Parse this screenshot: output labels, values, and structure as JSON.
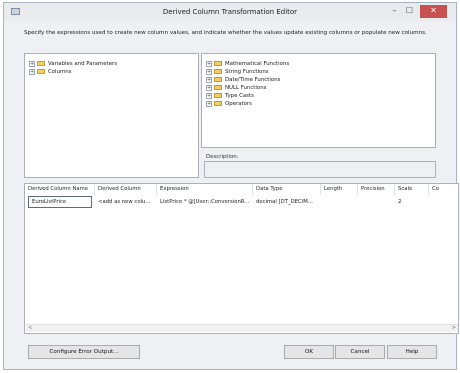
{
  "window": {
    "title": "Derived Column Transformation Editor",
    "controls": {
      "minimize": "–",
      "maximize": "☐",
      "close": "✕"
    }
  },
  "description": "Specify the expressions used to create new column values, and indicate whether the values update existing columns or populate new columns.",
  "left_tree": {
    "items": [
      {
        "expander": "+",
        "label": "Variables and Parameters"
      },
      {
        "expander": "+",
        "label": "Columns"
      }
    ]
  },
  "right_tree": {
    "items": [
      {
        "expander": "+",
        "label": "Mathematical Functions"
      },
      {
        "expander": "+",
        "label": "String Functions"
      },
      {
        "expander": "+",
        "label": "Date/Time Functions"
      },
      {
        "expander": "+",
        "label": "NULL Functions"
      },
      {
        "expander": "+",
        "label": "Type Casts"
      },
      {
        "expander": "+",
        "label": "Operators"
      }
    ]
  },
  "description_panel": {
    "label": "Description:"
  },
  "grid": {
    "columns": [
      "Derived Column Name",
      "Derived Column",
      "Expression",
      "Data Type",
      "Length",
      "Precision",
      "Scale",
      "Co"
    ],
    "rows": [
      {
        "name": "EuroListPrice",
        "derived_column": "<add as new colu...",
        "expression": "ListPrice * @[User::ConversionR...",
        "data_type": "decimal [DT_DECIM...",
        "length": "",
        "precision": "",
        "scale": "2",
        "code_page": ""
      }
    ],
    "scroll_left": "<",
    "scroll_right": ">"
  },
  "buttons": {
    "configure": "Configure Error Output...",
    "ok": "OK",
    "cancel": "Cancel",
    "help": "Help"
  }
}
